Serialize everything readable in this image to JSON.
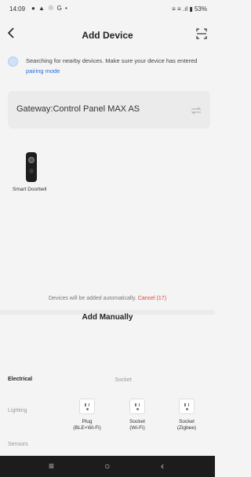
{
  "status_bar": {
    "time": "14:09",
    "icons_left": "● ▲ ☉ G •",
    "right": "≡ ≡ .ıl ▮ 53%"
  },
  "header": {
    "title": "Add Device"
  },
  "search": {
    "text": "Searching for nearby devices. Make sure your device has entered ",
    "link": "pairing mode"
  },
  "gateway": {
    "label": "Gateway:Control Panel MAX AS"
  },
  "discovered": [
    {
      "name": "Smart Doorbell"
    }
  ],
  "auto_add": {
    "text": "Devices will be added automatically. ",
    "cancel": "Cancel (17)"
  },
  "manual": {
    "title": "Add Manually",
    "categories": [
      "Electrical",
      "Lighting",
      "Sensors"
    ],
    "section_title": "Socket",
    "items": [
      {
        "label_line1": "Plug",
        "label_line2": "(BLE+Wi-Fi)"
      },
      {
        "label_line1": "Socket",
        "label_line2": "(Wi-Fi)"
      },
      {
        "label_line1": "Socket",
        "label_line2": "(Zigbee)"
      }
    ]
  },
  "nav": {
    "menu": "≡",
    "home": "○",
    "back": "‹"
  },
  "colors": {
    "accent": "#2a6ad8",
    "cancel": "#d9443f",
    "background": "#f4f4f4"
  }
}
